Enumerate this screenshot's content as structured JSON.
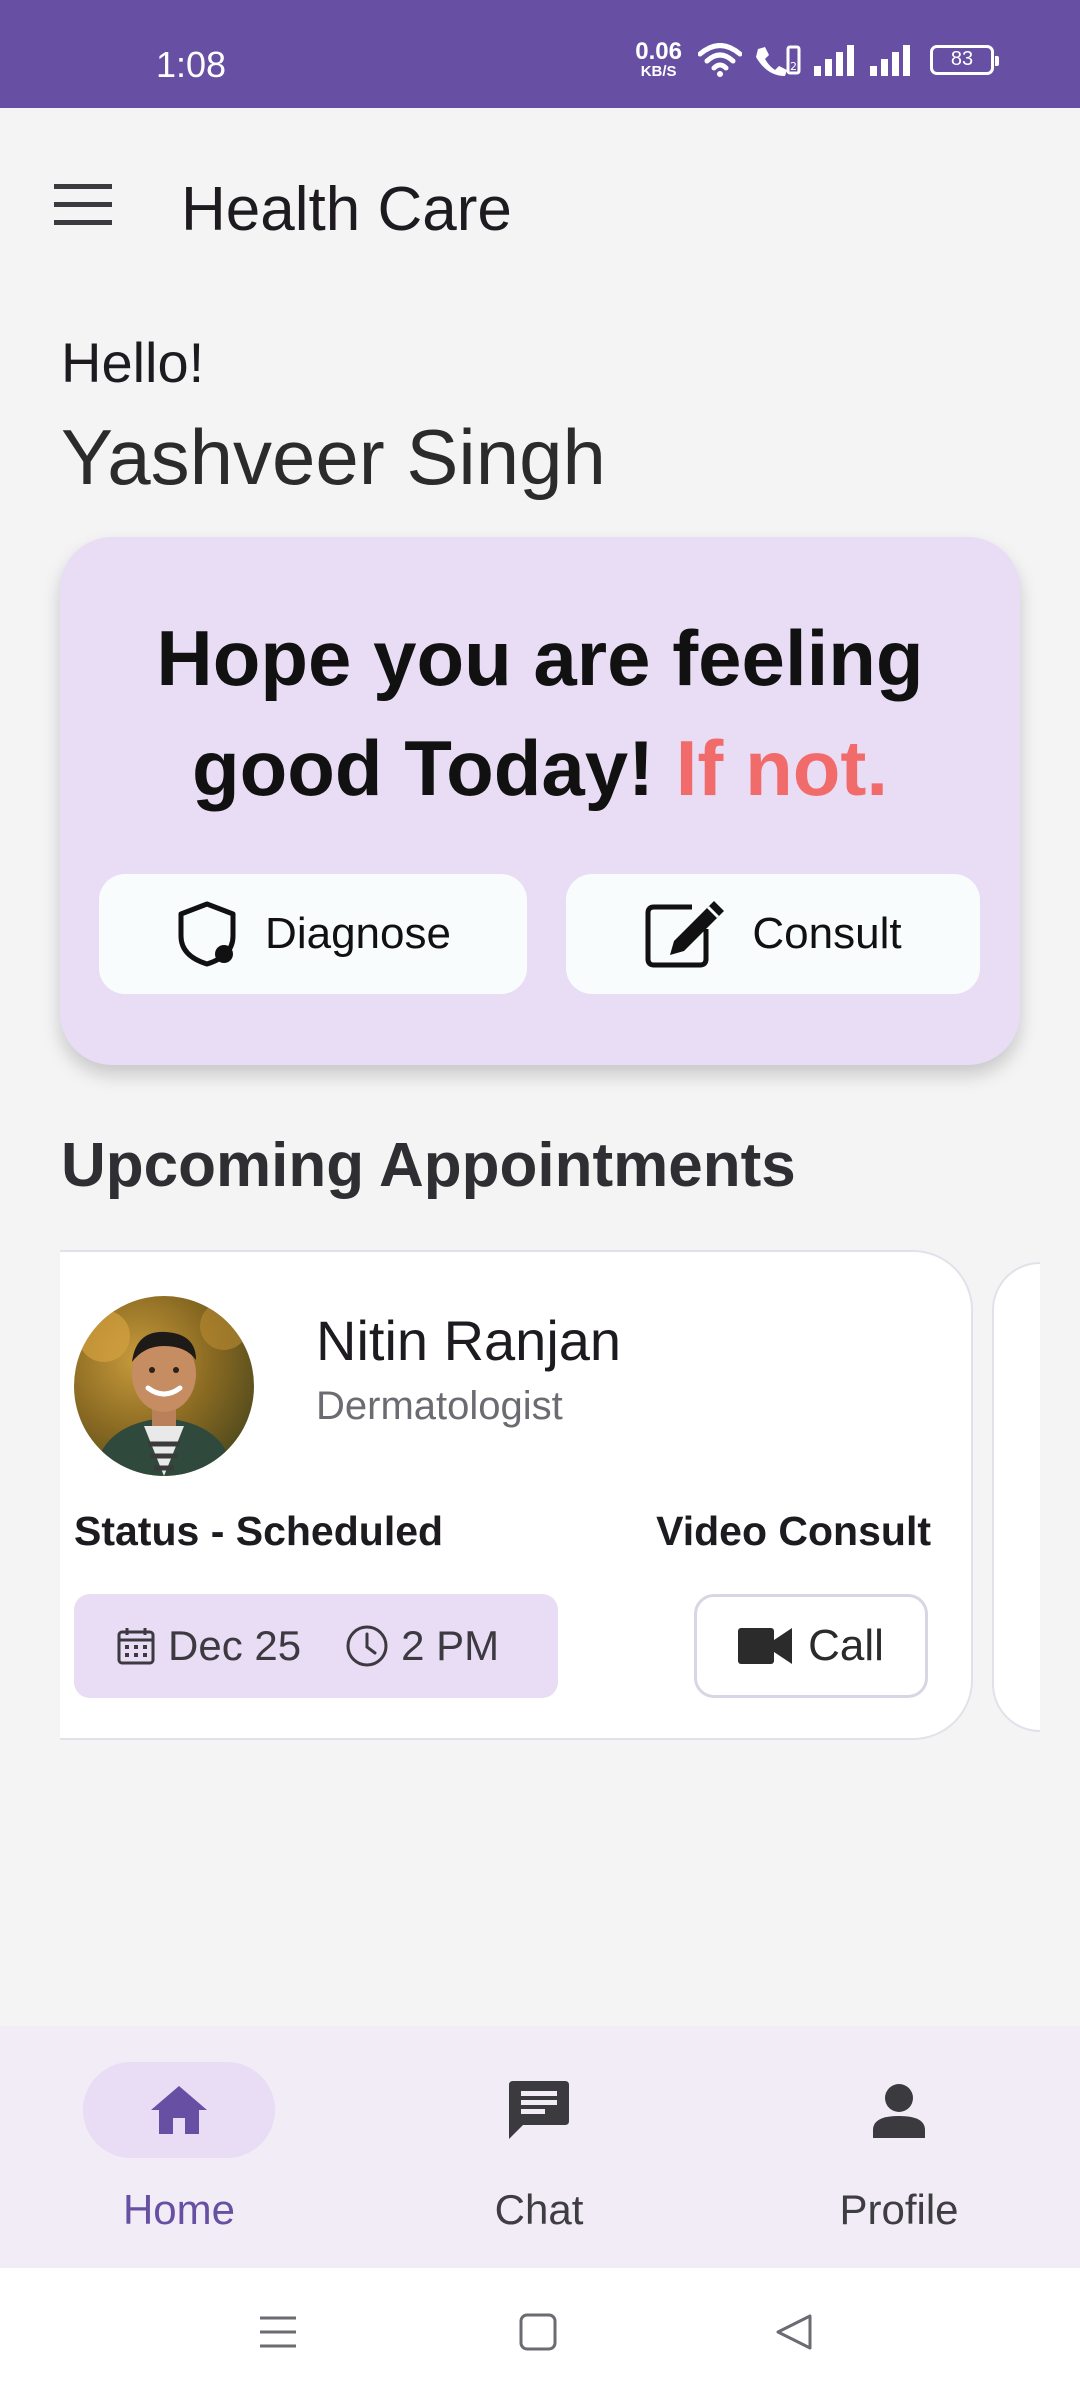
{
  "status_bar": {
    "time": "1:08",
    "net_speed_value": "0.06",
    "net_speed_unit": "KB/S",
    "battery": "83",
    "background_color": "#6750a4"
  },
  "app_bar": {
    "menu_icon": "hamburger-menu-icon",
    "title": "Health Care"
  },
  "greeting": {
    "hello": "Hello!",
    "name": "Yashveer Singh"
  },
  "hero": {
    "line1": "Hope you are feeling",
    "line2": "good Today!",
    "accent": "If not.",
    "accent_color": "#f26b6b",
    "card_color": "#e8ddf4",
    "buttons": [
      {
        "label": "Diagnose",
        "icon": "shield-icon"
      },
      {
        "label": "Consult",
        "icon": "edit-icon"
      }
    ]
  },
  "appointments": {
    "title": "Upcoming Appointments",
    "items": [
      {
        "doctor_name": "Nitin Ranjan",
        "specialty": "Dermatologist",
        "status": "Status - Scheduled",
        "consult_type": "Video Consult",
        "date": "Dec 25",
        "time": "2 PM",
        "action_label": "Call",
        "action_icon": "video-camera-icon"
      }
    ]
  },
  "bottom_nav": {
    "items": [
      {
        "label": "Home",
        "icon": "home-icon",
        "active": true
      },
      {
        "label": "Chat",
        "icon": "chat-icon",
        "active": false
      },
      {
        "label": "Profile",
        "icon": "person-icon",
        "active": false
      }
    ],
    "active_color": "#6750a4"
  },
  "system_nav": {
    "buttons": [
      "recents-icon",
      "home-square-icon",
      "back-triangle-icon"
    ]
  }
}
